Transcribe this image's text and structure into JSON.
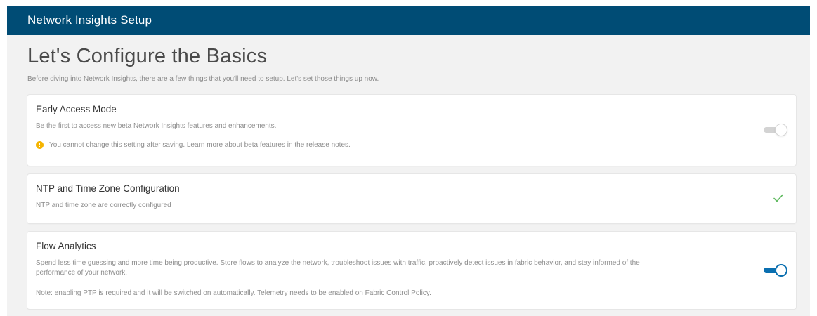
{
  "header": {
    "title": "Network Insights Setup"
  },
  "page": {
    "title": "Let's Configure the Basics",
    "subtitle": "Before diving into Network Insights, there are a few things that you'll need to setup. Let's set those things up now."
  },
  "sections": {
    "early_access": {
      "title": "Early Access Mode",
      "description": "Be the first to access new beta Network Insights features and enhancements.",
      "warning": "You cannot change this setting after saving. Learn more about beta features in the release notes.",
      "warning_icon": "warning-circle-icon",
      "enabled": false
    },
    "ntp": {
      "title": "NTP and Time Zone Configuration",
      "description": "NTP and time zone are correctly configured",
      "status_icon": "check-icon"
    },
    "flow": {
      "title": "Flow Analytics",
      "description": "Spend less time guessing and more time being productive. Store flows to analyze the network, troubleshoot issues with traffic, proactively detect issues in fabric behavior, and stay informed of the performance of your network.",
      "note": "Note: enabling PTP is required and it will be switched on automatically. Telemetry needs to be enabled on Fabric Control Policy.",
      "enabled": true
    }
  },
  "colors": {
    "header_bg": "#004c75",
    "accent": "#0a6fb0",
    "success": "#5cb85c",
    "warning": "#f5b400"
  }
}
